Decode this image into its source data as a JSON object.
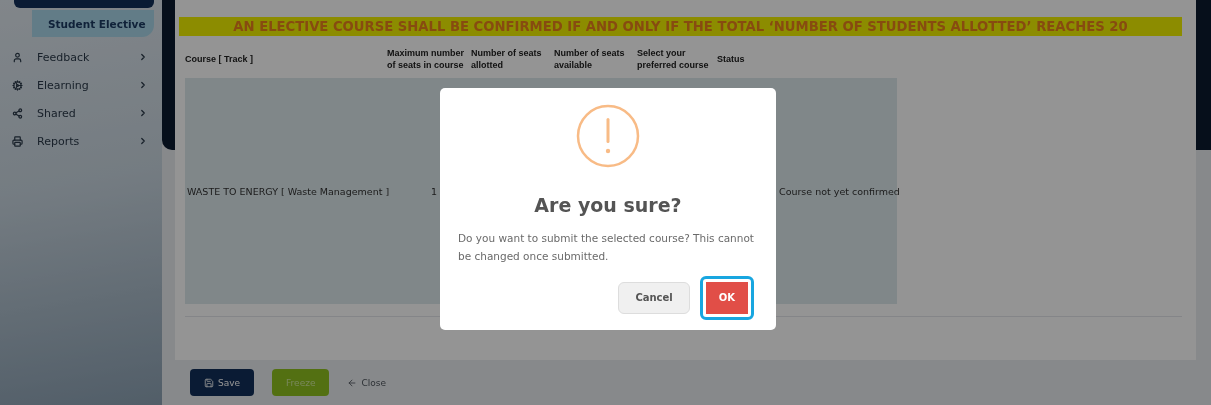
{
  "sidebar": {
    "items": [
      {
        "label": "Student Elective",
        "kind": "sub",
        "selected": true
      },
      {
        "label": "Feedback",
        "kind": "menu",
        "selected": false
      },
      {
        "label": "Elearning",
        "kind": "menu",
        "selected": false
      },
      {
        "label": "Shared",
        "kind": "menu",
        "selected": false
      },
      {
        "label": "Reports",
        "kind": "menu",
        "selected": false
      }
    ]
  },
  "notice": "AN ELECTIVE COURSE SHALL BE CONFIRMED IF AND ONLY IF THE TOTAL ‘NUMBER OF STUDENTS ALLOTTED’ REACHES 20",
  "table": {
    "columns": [
      "Course [ Track ]",
      "Maximum number of seats in course",
      "Number of seats allotted",
      "Number of seats available",
      "Select your preferred course",
      "Status"
    ],
    "rows": [
      {
        "cells": [
          "WASTE TO ENERGY [ Waste Management ]",
          "1",
          "",
          "",
          "",
          "Course not yet confirmed"
        ]
      }
    ]
  },
  "footer": {
    "buttons": [
      {
        "label": "Save",
        "kind": "primary",
        "disabled": false
      },
      {
        "label": "Freeze",
        "kind": "success",
        "disabled": true
      },
      {
        "label": "Close",
        "kind": "link",
        "disabled": false
      }
    ]
  },
  "dialog": {
    "title": "Are you sure?",
    "message": "Do you want to submit the selected course? This cannot be changed once submitted.",
    "buttons": [
      {
        "label": "Cancel",
        "kind": "cancel",
        "focused": false
      },
      {
        "label": "OK",
        "kind": "confirm",
        "focused": true
      }
    ]
  }
}
